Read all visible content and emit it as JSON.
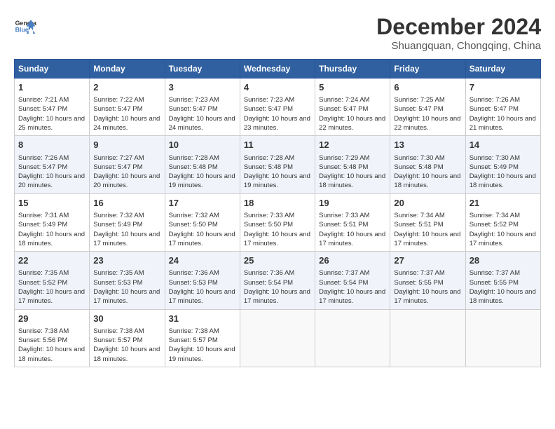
{
  "header": {
    "logo_line1": "General",
    "logo_line2": "Blue",
    "month": "December 2024",
    "location": "Shuangquan, Chongqing, China"
  },
  "weekdays": [
    "Sunday",
    "Monday",
    "Tuesday",
    "Wednesday",
    "Thursday",
    "Friday",
    "Saturday"
  ],
  "weeks": [
    [
      {
        "day": 1,
        "sunrise": "7:21 AM",
        "sunset": "5:47 PM",
        "daylight": "10 hours and 25 minutes."
      },
      {
        "day": 2,
        "sunrise": "7:22 AM",
        "sunset": "5:47 PM",
        "daylight": "10 hours and 24 minutes."
      },
      {
        "day": 3,
        "sunrise": "7:23 AM",
        "sunset": "5:47 PM",
        "daylight": "10 hours and 24 minutes."
      },
      {
        "day": 4,
        "sunrise": "7:23 AM",
        "sunset": "5:47 PM",
        "daylight": "10 hours and 23 minutes."
      },
      {
        "day": 5,
        "sunrise": "7:24 AM",
        "sunset": "5:47 PM",
        "daylight": "10 hours and 22 minutes."
      },
      {
        "day": 6,
        "sunrise": "7:25 AM",
        "sunset": "5:47 PM",
        "daylight": "10 hours and 22 minutes."
      },
      {
        "day": 7,
        "sunrise": "7:26 AM",
        "sunset": "5:47 PM",
        "daylight": "10 hours and 21 minutes."
      }
    ],
    [
      {
        "day": 8,
        "sunrise": "7:26 AM",
        "sunset": "5:47 PM",
        "daylight": "10 hours and 20 minutes."
      },
      {
        "day": 9,
        "sunrise": "7:27 AM",
        "sunset": "5:47 PM",
        "daylight": "10 hours and 20 minutes."
      },
      {
        "day": 10,
        "sunrise": "7:28 AM",
        "sunset": "5:48 PM",
        "daylight": "10 hours and 19 minutes."
      },
      {
        "day": 11,
        "sunrise": "7:28 AM",
        "sunset": "5:48 PM",
        "daylight": "10 hours and 19 minutes."
      },
      {
        "day": 12,
        "sunrise": "7:29 AM",
        "sunset": "5:48 PM",
        "daylight": "10 hours and 18 minutes."
      },
      {
        "day": 13,
        "sunrise": "7:30 AM",
        "sunset": "5:48 PM",
        "daylight": "10 hours and 18 minutes."
      },
      {
        "day": 14,
        "sunrise": "7:30 AM",
        "sunset": "5:49 PM",
        "daylight": "10 hours and 18 minutes."
      }
    ],
    [
      {
        "day": 15,
        "sunrise": "7:31 AM",
        "sunset": "5:49 PM",
        "daylight": "10 hours and 18 minutes."
      },
      {
        "day": 16,
        "sunrise": "7:32 AM",
        "sunset": "5:49 PM",
        "daylight": "10 hours and 17 minutes."
      },
      {
        "day": 17,
        "sunrise": "7:32 AM",
        "sunset": "5:50 PM",
        "daylight": "10 hours and 17 minutes."
      },
      {
        "day": 18,
        "sunrise": "7:33 AM",
        "sunset": "5:50 PM",
        "daylight": "10 hours and 17 minutes."
      },
      {
        "day": 19,
        "sunrise": "7:33 AM",
        "sunset": "5:51 PM",
        "daylight": "10 hours and 17 minutes."
      },
      {
        "day": 20,
        "sunrise": "7:34 AM",
        "sunset": "5:51 PM",
        "daylight": "10 hours and 17 minutes."
      },
      {
        "day": 21,
        "sunrise": "7:34 AM",
        "sunset": "5:52 PM",
        "daylight": "10 hours and 17 minutes."
      }
    ],
    [
      {
        "day": 22,
        "sunrise": "7:35 AM",
        "sunset": "5:52 PM",
        "daylight": "10 hours and 17 minutes."
      },
      {
        "day": 23,
        "sunrise": "7:35 AM",
        "sunset": "5:53 PM",
        "daylight": "10 hours and 17 minutes."
      },
      {
        "day": 24,
        "sunrise": "7:36 AM",
        "sunset": "5:53 PM",
        "daylight": "10 hours and 17 minutes."
      },
      {
        "day": 25,
        "sunrise": "7:36 AM",
        "sunset": "5:54 PM",
        "daylight": "10 hours and 17 minutes."
      },
      {
        "day": 26,
        "sunrise": "7:37 AM",
        "sunset": "5:54 PM",
        "daylight": "10 hours and 17 minutes."
      },
      {
        "day": 27,
        "sunrise": "7:37 AM",
        "sunset": "5:55 PM",
        "daylight": "10 hours and 17 minutes."
      },
      {
        "day": 28,
        "sunrise": "7:37 AM",
        "sunset": "5:55 PM",
        "daylight": "10 hours and 18 minutes."
      }
    ],
    [
      {
        "day": 29,
        "sunrise": "7:38 AM",
        "sunset": "5:56 PM",
        "daylight": "10 hours and 18 minutes."
      },
      {
        "day": 30,
        "sunrise": "7:38 AM",
        "sunset": "5:57 PM",
        "daylight": "10 hours and 18 minutes."
      },
      {
        "day": 31,
        "sunrise": "7:38 AM",
        "sunset": "5:57 PM",
        "daylight": "10 hours and 19 minutes."
      },
      null,
      null,
      null,
      null
    ]
  ]
}
